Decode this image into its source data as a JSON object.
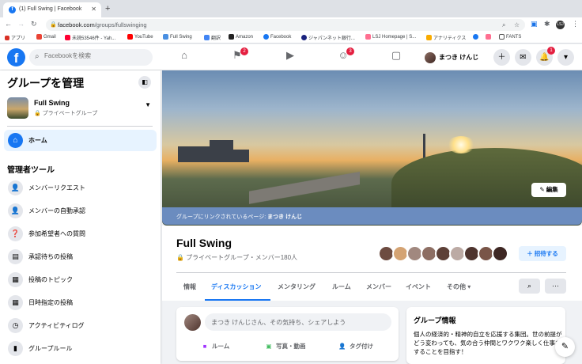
{
  "browser": {
    "tab_title": "(1) Full Swing | Facebook",
    "url_host": "facebook.com",
    "url_path": "/groups/fullswinging",
    "bookmarks": [
      "アプリ",
      "Gmail",
      "未読53546件 - Yah...",
      "YouTube",
      "Full Swing",
      "翻訳",
      "Amazon",
      "Facebook",
      "ジャパンネット銀行...",
      "LSJ Homepage | S...",
      "アナリティクス",
      "FANTS"
    ]
  },
  "fb_header": {
    "search_placeholder": "Facebookを検索",
    "flag_badge": "2",
    "groups_badge": "3",
    "notifications_badge": "1",
    "user_name": "まつき けんじ"
  },
  "sidebar": {
    "title": "グループを管理",
    "group_name": "Full Swing",
    "group_privacy": "プライベートグループ",
    "home_label": "ホーム",
    "admin_tools_heading": "管理者ツール",
    "items": [
      {
        "label": "メンバーリクエスト"
      },
      {
        "label": "メンバーの自動承認"
      },
      {
        "label": "参加希望者への質問"
      },
      {
        "label": "承認待ちの投稿"
      },
      {
        "label": "投稿のトピック"
      },
      {
        "label": "日時指定の投稿"
      },
      {
        "label": "アクティビティログ"
      },
      {
        "label": "グループルール"
      }
    ]
  },
  "cover": {
    "edit_label": "編集",
    "linked_page_prefix": "グループにリンクされているページ:",
    "linked_page_name": "まつき けんじ"
  },
  "group": {
    "name": "Full Swing",
    "meta": "プライベートグループ・メンバー180人",
    "invite_label": "招待する",
    "tabs": [
      "情報",
      "ディスカッション",
      "メンタリング",
      "ルーム",
      "メンバー",
      "イベント",
      "その他"
    ],
    "active_tab": "ディスカッション"
  },
  "composer": {
    "placeholder": "まつき けんじさん、その気持ち、シェアしよう",
    "actions": [
      "ルーム",
      "写真・動画",
      "タグ付け"
    ]
  },
  "about": {
    "heading": "グループ情報",
    "description": "個人の経済的・精神的自立を応援する集団。世の前提がどう変わっても、気の合う仲間とワクワク楽しく仕事をすることを目指す！"
  }
}
